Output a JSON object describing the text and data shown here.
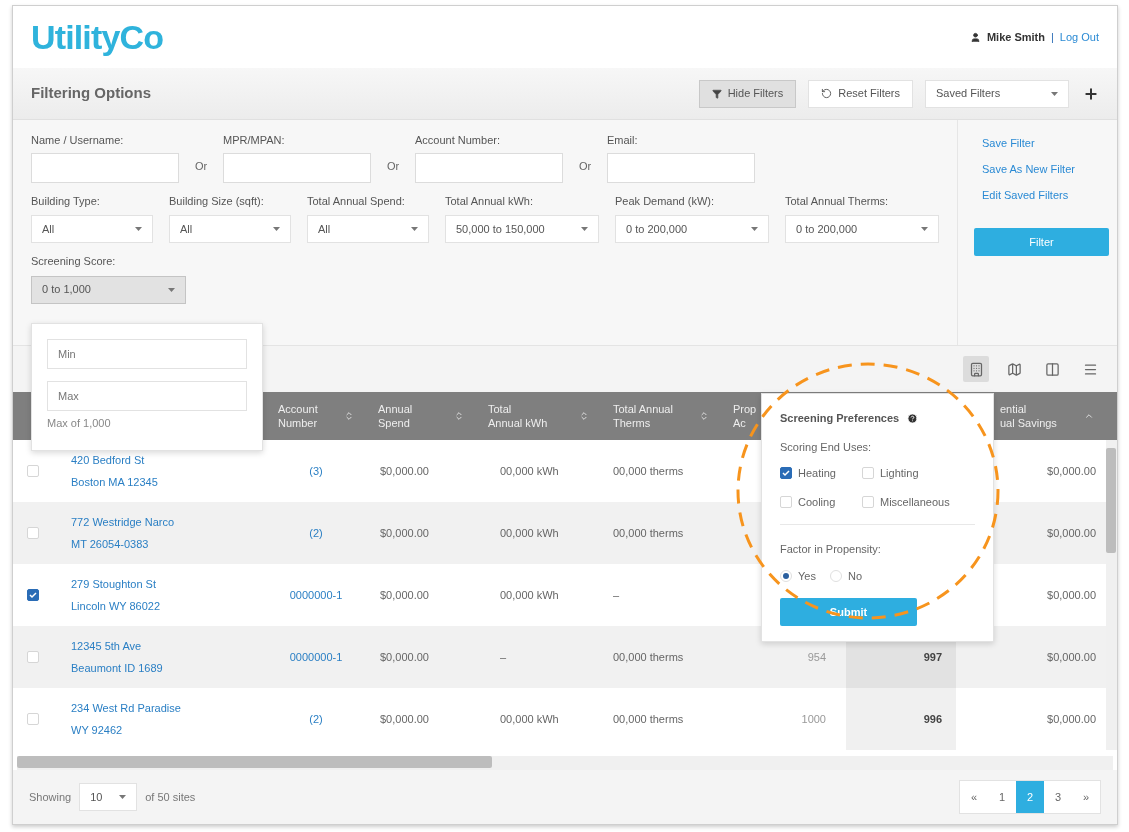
{
  "header": {
    "logo": "UtilityCo",
    "user": "Mike Smith",
    "separator": "|",
    "logout": "Log Out"
  },
  "filter_bar": {
    "title": "Filtering Options",
    "buttons": [
      {
        "label": "Hide Filters",
        "kind": "hide",
        "selected": true
      },
      {
        "label": "Reset Filters",
        "kind": "reset",
        "selected": false
      }
    ],
    "saved_filters": "Saved Filters"
  },
  "filters": {
    "text_fields": [
      {
        "label": "Name / Username:",
        "joiner": "Or"
      },
      {
        "label": "MPR/MPAN:",
        "joiner": "Or"
      },
      {
        "label": "Account Number:",
        "joiner": "Or"
      },
      {
        "label": "Email:"
      }
    ],
    "selects": [
      {
        "label": "Building Type:",
        "value": "All"
      },
      {
        "label": "Building Size (sqft):",
        "value": "All"
      },
      {
        "label": "Total Annual Spend:",
        "value": "All"
      },
      {
        "label": "Total Annual kWh:",
        "value": "50,000 to 150,000"
      },
      {
        "label": "Peak Demand (kW):",
        "value": "0 to 200,000"
      },
      {
        "label": "Total Annual Therms:",
        "value": "0 to 200,000"
      }
    ],
    "score": {
      "label": "Screening Score:",
      "value": "0 to 1,000",
      "open": true
    },
    "links": [
      "Save Filter",
      "Save As New Filter",
      "Edit Saved Filters"
    ],
    "filter_button": "Filter"
  },
  "score_popover": {
    "min_placeholder": "Min",
    "max_placeholder": "Max",
    "note": "Max of 1,000"
  },
  "toolbar": {
    "views": [
      {
        "kind": "building",
        "selected": true
      },
      {
        "kind": "map",
        "selected": false
      },
      {
        "kind": "columns",
        "selected": false
      },
      {
        "kind": "list",
        "selected": false
      }
    ]
  },
  "table": {
    "columns": [
      {
        "lines": [
          "Account",
          "Number"
        ],
        "sortable": true,
        "sorted": false
      },
      {
        "lines": [
          "Annual",
          "Spend"
        ],
        "sortable": true,
        "sorted": false
      },
      {
        "lines": [
          "Total",
          "Annual kWh"
        ],
        "sortable": true,
        "sorted": false
      },
      {
        "lines": [
          "Total Annual",
          "Therms"
        ],
        "sortable": true,
        "sorted": false
      },
      {
        "lines": [
          "Prop",
          "Ac"
        ]
      },
      {
        "lines": [
          "ential",
          "ual Savings"
        ],
        "sortable": true,
        "sorted": true
      }
    ],
    "rows": [
      {
        "checked": false,
        "address": [
          "420 Bedford St",
          "Boston MA 12345"
        ],
        "account": "(3)",
        "spend": "$0,000.00",
        "kwh": "00,000 kWh",
        "therms": "00,000 therms",
        "savings": "$0,000.00"
      },
      {
        "checked": false,
        "address": [
          "772 Westridge Narco",
          "MT 26054-0383"
        ],
        "account": "(2)",
        "spend": "$0,000.00",
        "kwh": "00,000 kWh",
        "therms": "00,000 therms",
        "savings": "$0,000.00"
      },
      {
        "checked": true,
        "address": [
          "279 Stoughton St",
          "Lincoln WY 86022"
        ],
        "account": "0000000-1",
        "spend": "$0,000.00",
        "kwh": "00,000 kWh",
        "therms": "–",
        "savings": "$0,000.00"
      },
      {
        "checked": false,
        "address": [
          "12345 5th Ave",
          "Beaumont ID 1689"
        ],
        "account": "0000000-1",
        "spend": "$0,000.00",
        "kwh": "–",
        "therms": "00,000 therms",
        "propensity": "954",
        "score": "997",
        "savings": "$0,000.00"
      },
      {
        "checked": false,
        "address": [
          "234 West Rd Paradise",
          "WY 92462"
        ],
        "account": "(2)",
        "spend": "$0,000.00",
        "kwh": "00,000 kWh",
        "therms": "00,000 therms",
        "propensity": "1000",
        "score": "996",
        "savings": "$0,000.00"
      }
    ]
  },
  "preferences": {
    "title": "Screening Preferences",
    "end_uses_label": "Scoring End Uses:",
    "end_uses": [
      {
        "label": "Heating",
        "checked": true
      },
      {
        "label": "Lighting",
        "checked": false
      },
      {
        "label": "Cooling",
        "checked": false
      },
      {
        "label": "Miscellaneous",
        "checked": false
      }
    ],
    "propensity_label": "Factor in Propensity:",
    "propensity_options": [
      {
        "label": "Yes",
        "selected": true
      },
      {
        "label": "No",
        "selected": false
      }
    ],
    "submit": "Submit"
  },
  "footer": {
    "showing": "Showing",
    "page_size": "10",
    "of_total": "of 50 sites",
    "pages": [
      {
        "label": "«",
        "selected": false
      },
      {
        "label": "1",
        "selected": false
      },
      {
        "label": "2",
        "selected": true
      },
      {
        "label": "3",
        "selected": false
      },
      {
        "label": "»",
        "selected": false
      }
    ]
  }
}
